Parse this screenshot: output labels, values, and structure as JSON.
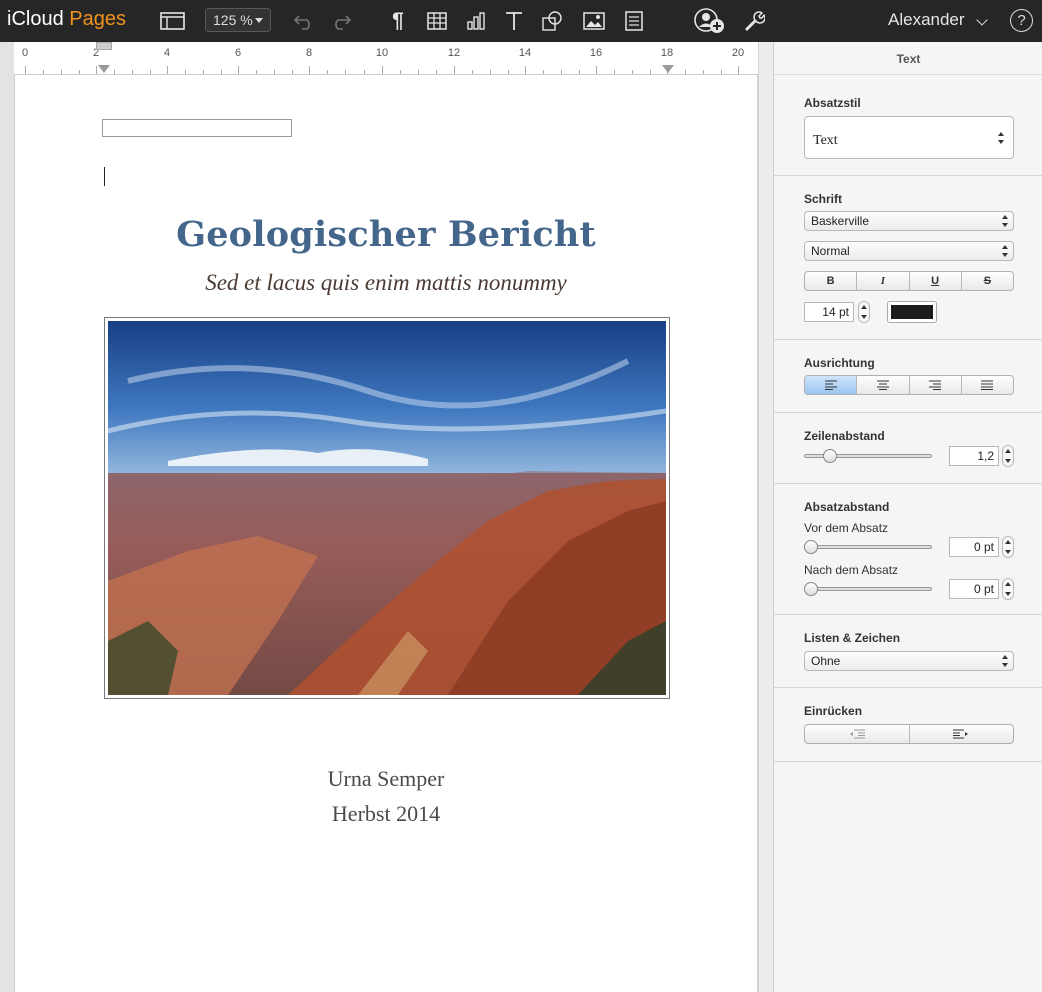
{
  "toolbar": {
    "brand_prefix": "iCloud",
    "brand_app": "Pages",
    "zoom": "125 %",
    "user": "Alexander",
    "help": "?",
    "icons": [
      "view-icon",
      "undo-icon",
      "redo-icon",
      "paragraph-icon",
      "table-icon",
      "chart-icon",
      "text-icon",
      "shape-icon",
      "image-icon",
      "comment-icon",
      "collaborate-icon",
      "tools-icon"
    ]
  },
  "ruler": {
    "labels": [
      "0",
      "2",
      "4",
      "6",
      "8",
      "10",
      "12",
      "14",
      "16",
      "18",
      "20"
    ]
  },
  "document": {
    "title": "Geologischer Bericht",
    "subtitle": "Sed et lacus quis enim mattis nonummy",
    "author": "Urna Semper",
    "season": "Herbst 2014"
  },
  "inspector": {
    "title": "Text",
    "paragraph_style": {
      "label": "Absatzstil",
      "value": "Text"
    },
    "font": {
      "label": "Schrift",
      "family": "Baskerville",
      "typeface": "Normal",
      "bold": "B",
      "italic": "I",
      "underline": "U",
      "strike": "S",
      "size": "14 pt",
      "color": "#1c1c1c"
    },
    "alignment": {
      "label": "Ausrichtung",
      "active": "left"
    },
    "line_spacing": {
      "label": "Zeilenabstand",
      "value": "1,2",
      "level": 0.2
    },
    "paragraph_spacing": {
      "label": "Absatzabstand",
      "before_label": "Vor dem Absatz",
      "before_value": "0 pt",
      "after_label": "Nach dem Absatz",
      "after_value": "0 pt"
    },
    "lists": {
      "label": "Listen & Zeichen",
      "value": "Ohne"
    },
    "indent": {
      "label": "Einrücken"
    }
  },
  "colors": {
    "accent_orange": "#f0941f",
    "title_blue": "#44668b",
    "toolbar_bg": "#262626",
    "selected_blue": "#9dc6f0"
  }
}
